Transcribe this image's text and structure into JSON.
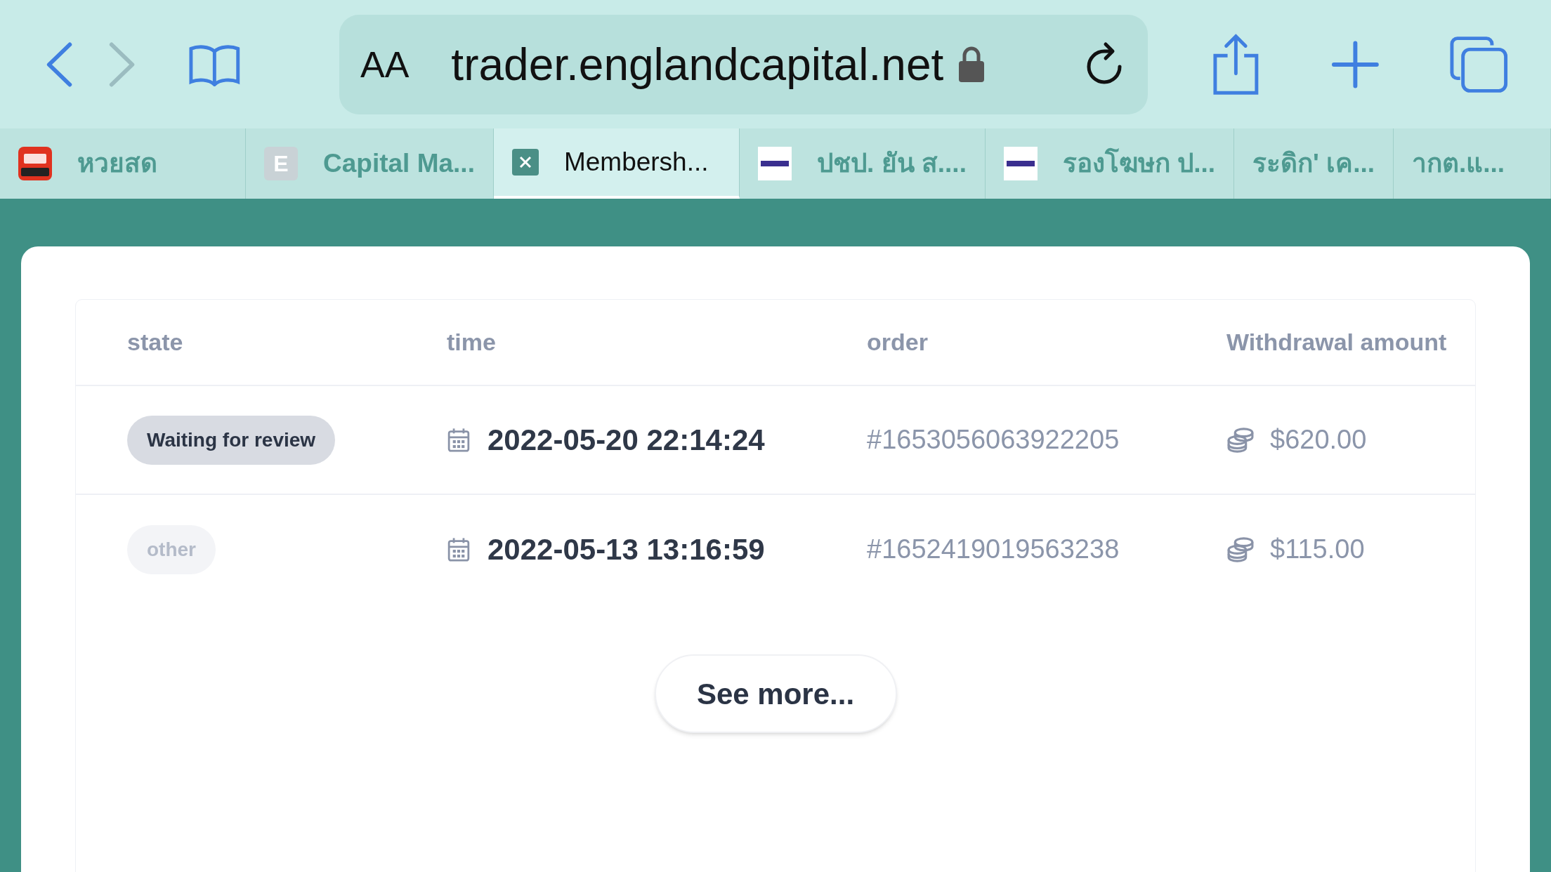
{
  "toolbar": {
    "back_disabled": false,
    "forward_disabled": true,
    "text_size_label": "AA",
    "url": "trader.englandcapital.net"
  },
  "tabs": [
    {
      "label": "หวยสด",
      "selected": false,
      "kind": "lottery"
    },
    {
      "label": "Capital Ma...",
      "selected": false,
      "kind": "letter",
      "letter": "E"
    },
    {
      "label": "Membersh...",
      "selected": true,
      "kind": "close"
    },
    {
      "label": "ปชป. ยัน ส....",
      "selected": false,
      "kind": "news"
    },
    {
      "label": "รองโฆษก ป...",
      "selected": false,
      "kind": "news"
    },
    {
      "label": "ระดิก' เค...",
      "selected": false,
      "kind": "none"
    },
    {
      "label": "ากต.แ...",
      "selected": false,
      "kind": "none"
    }
  ],
  "table": {
    "columns": [
      "state",
      "time",
      "order",
      "Withdrawal amount"
    ],
    "rows": [
      {
        "state": "Waiting for review",
        "kind": "review",
        "time": "2022-05-20 22:14:24",
        "order": "#1653056063922205",
        "amount": "$620.00"
      },
      {
        "state": "other",
        "kind": "other",
        "time": "2022-05-13 13:16:59",
        "order": "#1652419019563238",
        "amount": "$115.00"
      }
    ]
  },
  "see_more": "See more..."
}
